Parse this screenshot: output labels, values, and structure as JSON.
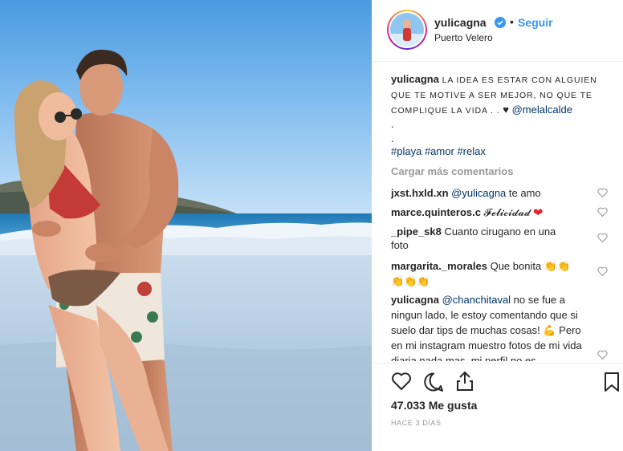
{
  "post": {
    "username": "yulicagna",
    "follow_label": "Seguir",
    "separator": "•",
    "location": "Puerto Velero",
    "verified_icon": "verified-badge-icon",
    "colors": {
      "accent": "#3897f0",
      "link": "#003569",
      "muted": "#999999",
      "heart_red": "#e0242c"
    }
  },
  "caption": {
    "username": "yulicagna",
    "text": "LA IDEA ES ESTAR CON ALGUIEN QUE TE MOTIVE A SER MEJOR, NO QUE TE COMPLIQUE LA VIDA . .",
    "heart": "♥",
    "mention": "@melalcalde",
    "dot1": ".",
    "dot2": ".",
    "hashtags": [
      "#playa",
      "#amor",
      "#relax"
    ]
  },
  "load_more": "Cargar más comentarios",
  "comments": [
    {
      "username": "jxst.hxld.xn",
      "mention": "@yulicagna",
      "text": " te amo"
    },
    {
      "username": "marce.quinteros.c",
      "text": "𝓕𝓮𝓵𝓲𝓬𝓲𝓭𝓪𝓭",
      "emoji": "❤"
    },
    {
      "username": "_pipe_sk8",
      "text": "Cuanto cirugano en una foto"
    },
    {
      "username": "margarita._morales",
      "text": "Que bonita",
      "emoji": "👏👏👏👏👏"
    },
    {
      "username": "yulicagna",
      "mention": "@chanchitaval",
      "text": " no se fue a ningun lado, le estoy comentando que si suelo dar tips de muchas cosas!",
      "emoji": "💪",
      "text2": "Pero en mi instagram muestro fotos de mi vida diaria nada mas, mi perfil no es"
    }
  ],
  "actions": {
    "like_icon": "heart-outline-icon",
    "comment_icon": "comment-icon",
    "share_icon": "share-icon",
    "save_icon": "bookmark-icon"
  },
  "likes_label": "47.033 Me gusta",
  "timestamp": "HACE 3 DÍAS"
}
